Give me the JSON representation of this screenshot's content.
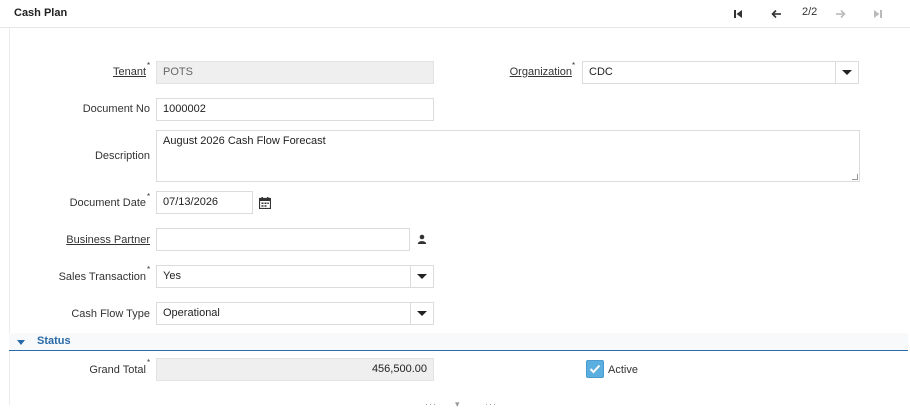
{
  "window": {
    "title": "Cash Plan"
  },
  "nav": {
    "pager": "2/2"
  },
  "form": {
    "tenant": {
      "label": "Tenant",
      "value": "POTS"
    },
    "organization": {
      "label": "Organization",
      "value": "CDC"
    },
    "document_no": {
      "label": "Document No",
      "value": "1000002"
    },
    "description": {
      "label": "Description",
      "value": "August 2026 Cash Flow Forecast"
    },
    "document_date": {
      "label": "Document Date",
      "value": "07/13/2026"
    },
    "business_partner": {
      "label": "Business Partner",
      "value": ""
    },
    "sales_transaction": {
      "label": "Sales Transaction",
      "value": "Yes"
    },
    "cash_flow_type": {
      "label": "Cash Flow Type",
      "value": "Operational"
    }
  },
  "status_section": {
    "label": "Status",
    "grand_total": {
      "label": "Grand Total",
      "value": "456,500.00"
    },
    "active": {
      "label": "Active",
      "checked": true
    }
  },
  "icons": {
    "first": "first-record-icon",
    "prev": "previous-record-icon",
    "next": "next-record-icon",
    "last": "last-record-icon",
    "calendar": "calendar-icon",
    "person": "person-icon"
  },
  "colors": {
    "accent": "#2b6aa8",
    "checkbox": "#5aaee0",
    "readonly_bg": "#efefef"
  }
}
